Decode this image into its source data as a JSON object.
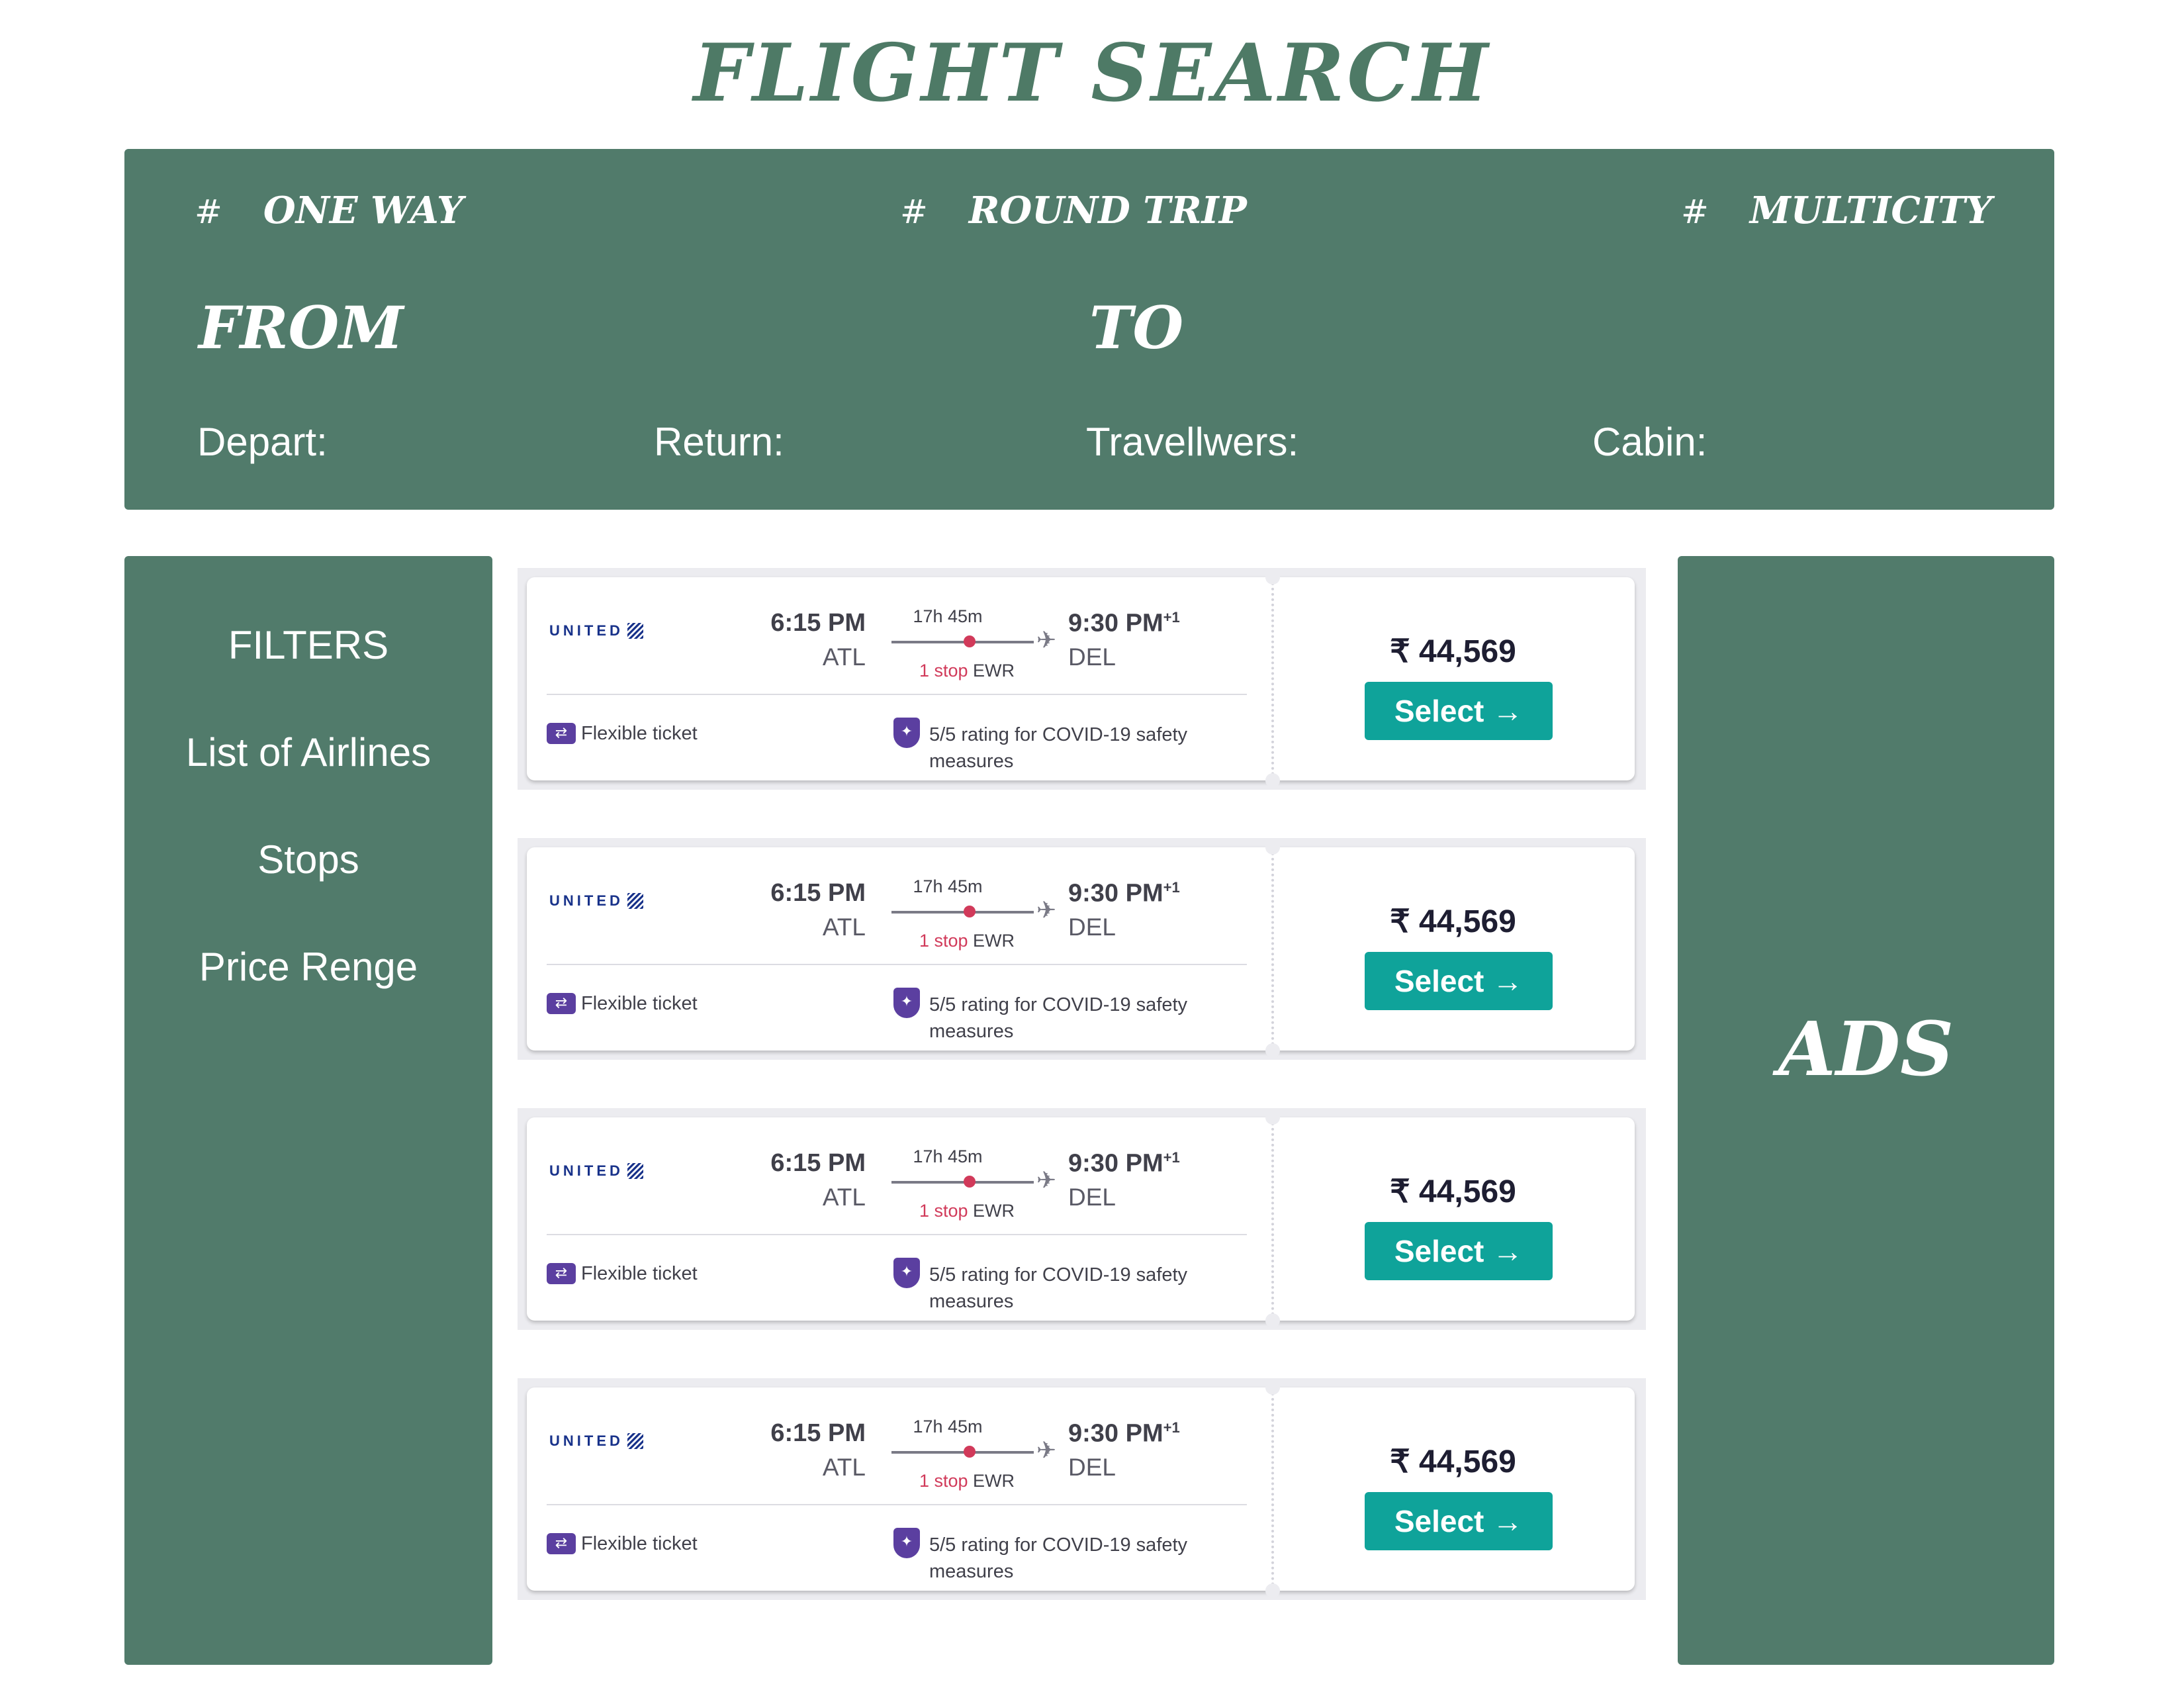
{
  "page": {
    "title": "FLIGHT SEARCH"
  },
  "search": {
    "trip_types": [
      {
        "hash": "#",
        "label": "ONE WAY"
      },
      {
        "hash": "#",
        "label": "ROUND TRIP"
      },
      {
        "hash": "#",
        "label": "MULTICITY"
      }
    ],
    "from_label": "FROM",
    "to_label": "TO",
    "depart_label": "Depart:",
    "return_label": "Return:",
    "travellers_label": "Travellwers:",
    "cabin_label": "Cabin:"
  },
  "filters": {
    "heading": "FILTERS",
    "items": [
      "List of Airlines",
      "Stops",
      "Price Renge"
    ]
  },
  "ads": {
    "label": "ADS"
  },
  "flights": [
    {
      "airline": "UNITED",
      "dep_time": "6:15 PM",
      "dep_code": "ATL",
      "duration": "17h 45m",
      "stop_count": "1 stop",
      "stop_code": "EWR",
      "arr_time": "9:30 PM",
      "arr_day_offset": "+1",
      "arr_code": "DEL",
      "flexible_label": "Flexible ticket",
      "covid_label": "5/5 rating for COVID-19 safety measures",
      "price": "₹ 44,569",
      "select_label": "Select →"
    },
    {
      "airline": "UNITED",
      "dep_time": "6:15 PM",
      "dep_code": "ATL",
      "duration": "17h 45m",
      "stop_count": "1 stop",
      "stop_code": "EWR",
      "arr_time": "9:30 PM",
      "arr_day_offset": "+1",
      "arr_code": "DEL",
      "flexible_label": "Flexible ticket",
      "covid_label": "5/5 rating for COVID-19 safety measures",
      "price": "₹ 44,569",
      "select_label": "Select →"
    },
    {
      "airline": "UNITED",
      "dep_time": "6:15 PM",
      "dep_code": "ATL",
      "duration": "17h 45m",
      "stop_count": "1 stop",
      "stop_code": "EWR",
      "arr_time": "9:30 PM",
      "arr_day_offset": "+1",
      "arr_code": "DEL",
      "flexible_label": "Flexible ticket",
      "covid_label": "5/5 rating for COVID-19 safety measures",
      "price": "₹ 44,569",
      "select_label": "Select →"
    },
    {
      "airline": "UNITED",
      "dep_time": "6:15 PM",
      "dep_code": "ATL",
      "duration": "17h 45m",
      "stop_count": "1 stop",
      "stop_code": "EWR",
      "arr_time": "9:30 PM",
      "arr_day_offset": "+1",
      "arr_code": "DEL",
      "flexible_label": "Flexible ticket",
      "covid_label": "5/5 rating for COVID-19 safety measures",
      "price": "₹ 44,569",
      "select_label": "Select →"
    }
  ],
  "icons": {
    "plane": "airplane-icon",
    "flexible": "ticket-swap-icon",
    "covid": "shield-icon",
    "airline_logo": "united-globe-icon"
  },
  "colors": {
    "panel_green": "#517b6b",
    "title_green": "#4e7a66",
    "select_teal": "#0fa39a",
    "stop_red": "#d13a5a",
    "icon_purple": "#5b3fa0"
  }
}
